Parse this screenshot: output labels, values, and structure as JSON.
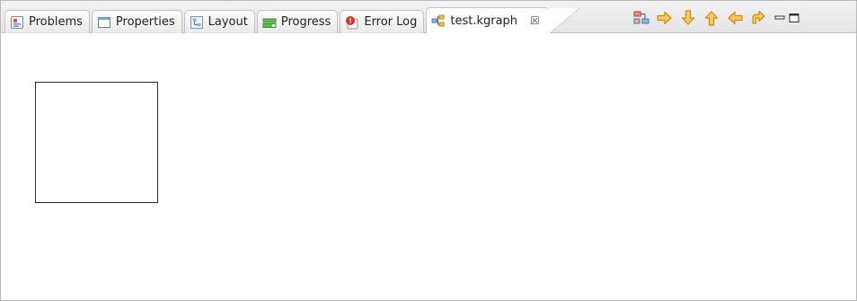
{
  "tabs": [
    {
      "label": "Problems",
      "icon": "problems-icon"
    },
    {
      "label": "Properties",
      "icon": "properties-icon"
    },
    {
      "label": "Layout",
      "icon": "layout-icon"
    },
    {
      "label": "Progress",
      "icon": "progress-icon"
    },
    {
      "label": "Error Log",
      "icon": "error-log-icon"
    },
    {
      "label": "test.kgraph",
      "icon": "kgraph-icon",
      "close_glyph": "☒"
    }
  ],
  "toolbar": {
    "icons": [
      "layout-graph-icon",
      "arrow-right-icon",
      "arrow-down-icon",
      "arrow-up-icon",
      "arrow-left-icon",
      "arrow-rotate-icon"
    ],
    "arrow_color": "#f0a51e",
    "minimize_glyph": "▬",
    "maximize_glyph": "▭"
  },
  "colors": {
    "tab_bg": "#e9e9e9",
    "node_border": "#2a2a2a"
  }
}
